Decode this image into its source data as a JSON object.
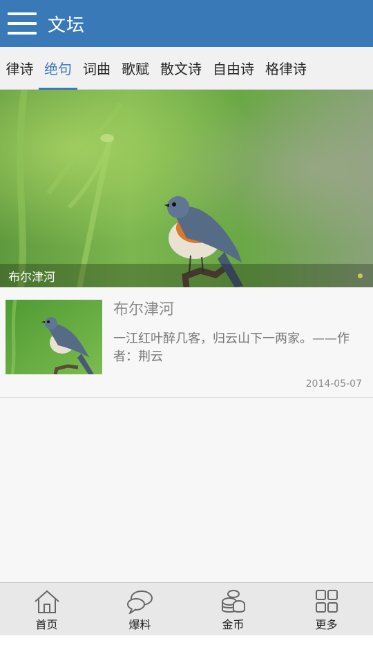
{
  "header": {
    "title": "文坛",
    "menu_icon": "hamburger-menu-icon"
  },
  "tabs": [
    {
      "label": "律诗",
      "active": false
    },
    {
      "label": "绝句",
      "active": true
    },
    {
      "label": "词曲",
      "active": false
    },
    {
      "label": "歌赋",
      "active": false
    },
    {
      "label": "散文诗",
      "active": false
    },
    {
      "label": "自由诗",
      "active": false
    },
    {
      "label": "格律诗",
      "active": false
    }
  ],
  "banner": {
    "caption": "布尔津河",
    "image": "bird-on-branch-photo",
    "indicator_color": "#d6c25a"
  },
  "articles": [
    {
      "title": "布尔津河",
      "summary": "一江红叶醉几客，归云山下一两家。——作者：荆云",
      "date": "2014-05-07",
      "thumbnail": "bird-on-branch-photo"
    }
  ],
  "bottom_nav": [
    {
      "label": "首页",
      "icon": "home-icon"
    },
    {
      "label": "爆料",
      "icon": "chat-bubbles-icon"
    },
    {
      "label": "金币",
      "icon": "coins-icon"
    },
    {
      "label": "更多",
      "icon": "grid-icon"
    }
  ],
  "colors": {
    "primary": "#3a79b7",
    "tab_bg": "#f1f1f1",
    "page_bg": "#f7f7f7"
  }
}
